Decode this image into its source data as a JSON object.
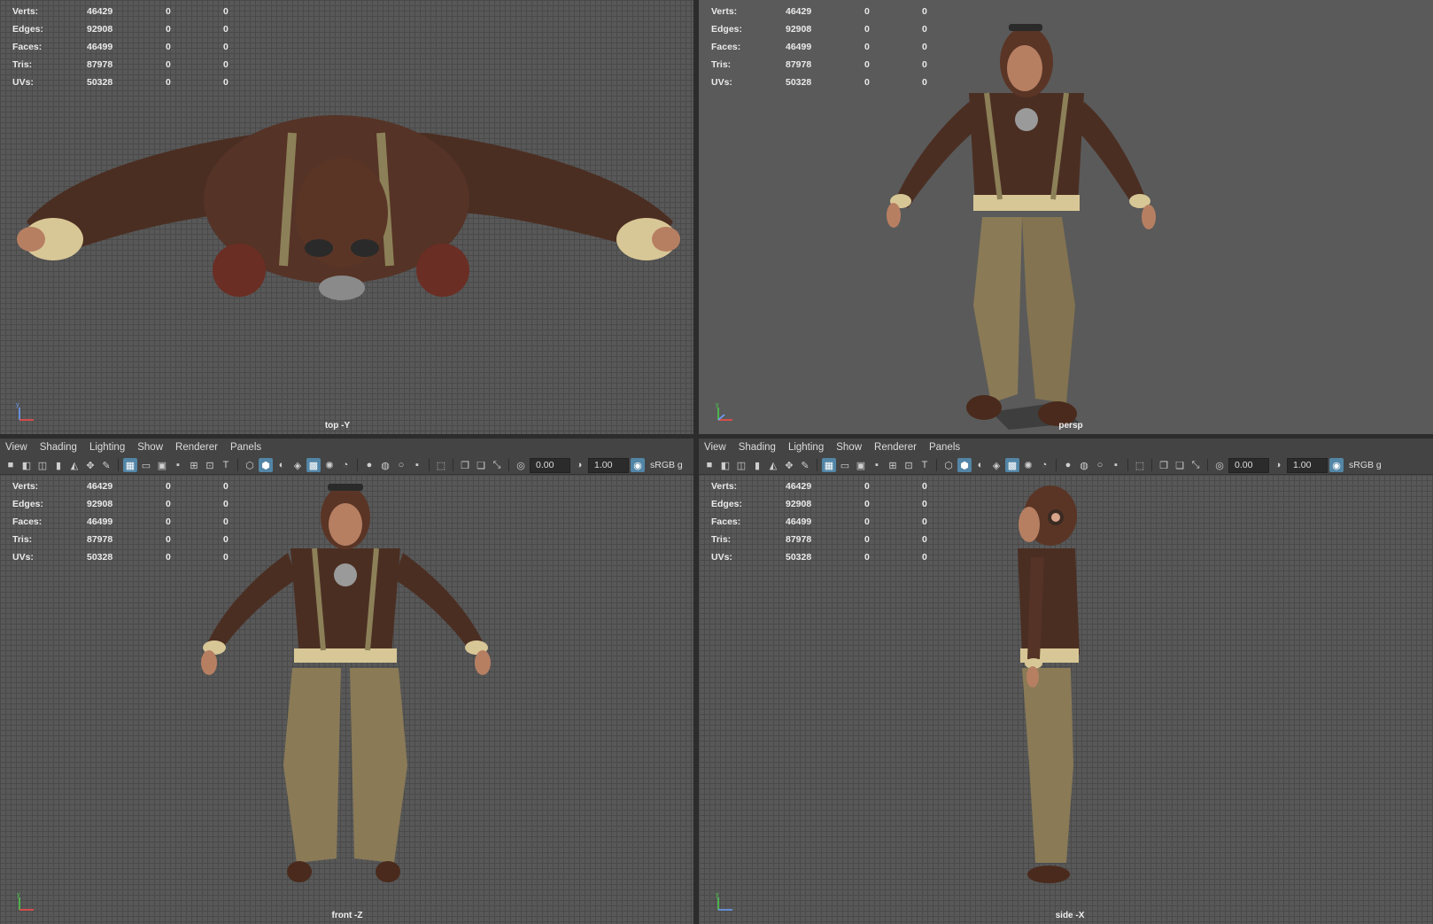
{
  "menu": [
    "View",
    "Shading",
    "Lighting",
    "Show",
    "Renderer",
    "Panels"
  ],
  "hud": [
    {
      "label": "Verts:",
      "v1": "46429",
      "v2": "0",
      "v3": "0"
    },
    {
      "label": "Edges:",
      "v1": "92908",
      "v2": "0",
      "v3": "0"
    },
    {
      "label": "Faces:",
      "v1": "46499",
      "v2": "0",
      "v3": "0"
    },
    {
      "label": "Tris:",
      "v1": "87978",
      "v2": "0",
      "v3": "0"
    },
    {
      "label": "UVs:",
      "v1": "50328",
      "v2": "0",
      "v3": "0"
    }
  ],
  "toolbar": {
    "exposure": "0.00",
    "gamma": "1.00",
    "colorspace": "sRGB g"
  },
  "viewports": {
    "top": {
      "camera": "top -Y"
    },
    "persp": {
      "camera": "persp"
    },
    "front": {
      "camera": "front -Z"
    },
    "side": {
      "camera": "side -X"
    }
  },
  "colors": {
    "jacket": "#4b2e22",
    "cuff": "#d8c796",
    "pants": "#8a7a56",
    "skin": "#b77f62",
    "boots": "#4a2a1c",
    "selection_blue": "#5285a6"
  }
}
